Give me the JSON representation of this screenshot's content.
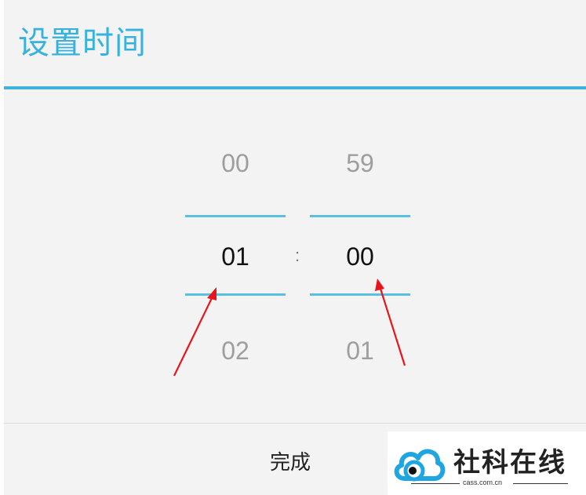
{
  "dialog": {
    "title": "设置时间",
    "accent_color": "#3fb3de"
  },
  "time_picker": {
    "hour": {
      "prev": "00",
      "current": "01",
      "next": "02"
    },
    "separator": ":",
    "minute": {
      "prev": "59",
      "current": "00",
      "next": "01"
    }
  },
  "footer": {
    "done_label": "完成"
  },
  "annotations": {
    "arrow_color": "#e8141a",
    "icon": "red-arrow-icon"
  },
  "watermark": {
    "text": "社科在线",
    "url": "cass.com.cn",
    "logo_icon": "cloud-eye-logo-icon",
    "logo_color": "#1fa5df"
  }
}
